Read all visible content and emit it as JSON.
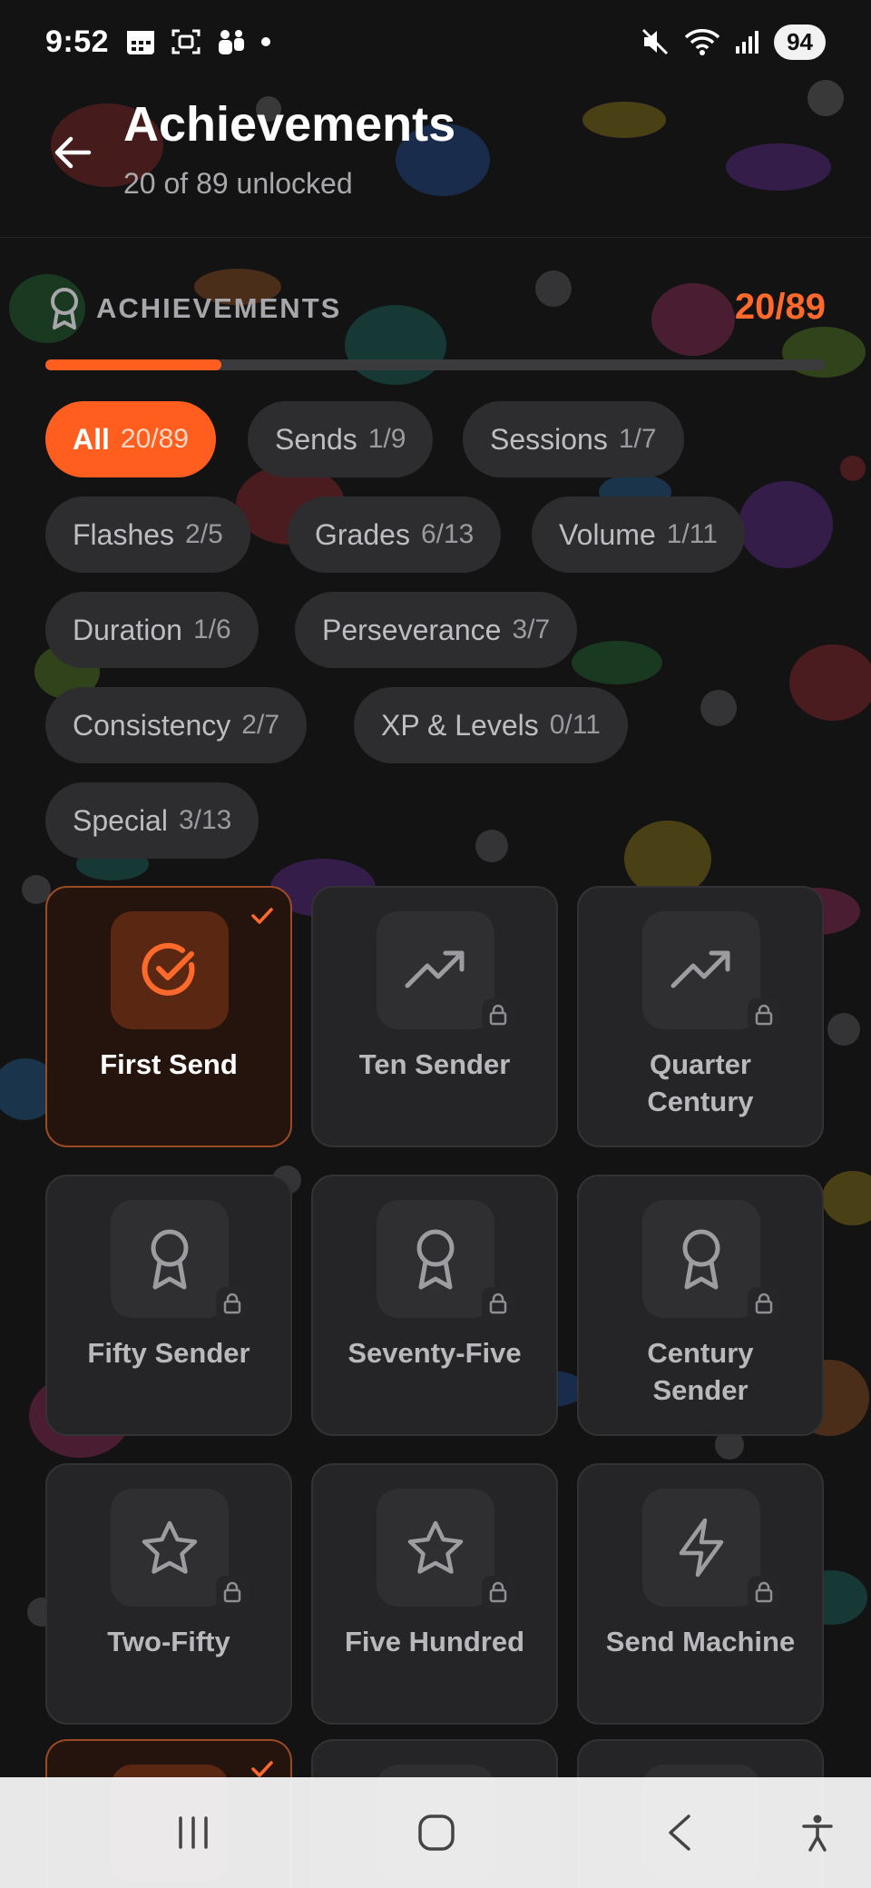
{
  "status_bar": {
    "time": "9:52",
    "battery": "94",
    "left_icons": [
      "calendar-icon",
      "screenshot-icon",
      "teams-icon",
      "notification-dot-icon"
    ],
    "right_icons": [
      "mute-icon",
      "wifi-icon",
      "signal-icon"
    ]
  },
  "header": {
    "title": "Achievements",
    "subtitle": "20 of 89 unlocked",
    "back_icon": "arrow-left-icon"
  },
  "section": {
    "label": "ACHIEVEMENTS",
    "count": "20/89",
    "progress_fraction": 0.225,
    "icon": "award-icon"
  },
  "filters": [
    {
      "label": "All",
      "count": "20/89",
      "active": true
    },
    {
      "label": "Sends",
      "count": "1/9",
      "active": false
    },
    {
      "label": "Sessions",
      "count": "1/7",
      "active": false
    },
    {
      "label": "Flashes",
      "count": "2/5",
      "active": false
    },
    {
      "label": "Grades",
      "count": "6/13",
      "active": false
    },
    {
      "label": "Volume",
      "count": "1/11",
      "active": false
    },
    {
      "label": "Duration",
      "count": "1/6",
      "active": false
    },
    {
      "label": "Perseverance",
      "count": "3/7",
      "active": false
    },
    {
      "label": "Consistency",
      "count": "2/7",
      "active": false
    },
    {
      "label": "XP & Levels",
      "count": "0/11",
      "active": false
    },
    {
      "label": "Special",
      "count": "3/13",
      "active": false
    }
  ],
  "achievements": [
    {
      "title": "First Send",
      "icon": "check-circle-icon",
      "unlocked": true
    },
    {
      "title": "Ten Sender",
      "icon": "trending-up-icon",
      "unlocked": false
    },
    {
      "title": "Quarter Century",
      "icon": "trending-up-icon",
      "unlocked": false
    },
    {
      "title": "Fifty Sender",
      "icon": "award-icon",
      "unlocked": false
    },
    {
      "title": "Seventy-Five",
      "icon": "award-icon",
      "unlocked": false
    },
    {
      "title": "Century Sender",
      "icon": "award-icon",
      "unlocked": false
    },
    {
      "title": "Two-Fifty",
      "icon": "star-icon",
      "unlocked": false
    },
    {
      "title": "Five Hundred",
      "icon": "star-icon",
      "unlocked": false
    },
    {
      "title": "Send Machine",
      "icon": "lightning-icon",
      "unlocked": false
    }
  ],
  "nav": {
    "icons": [
      "recent-apps-icon",
      "home-icon",
      "back-icon",
      "accessibility-icon"
    ]
  },
  "colors": {
    "accent": "#ff5e1f",
    "accent_text": "#ff6a2c",
    "background": "#121213",
    "card": "#252527",
    "card_unlocked": "#25140d"
  }
}
